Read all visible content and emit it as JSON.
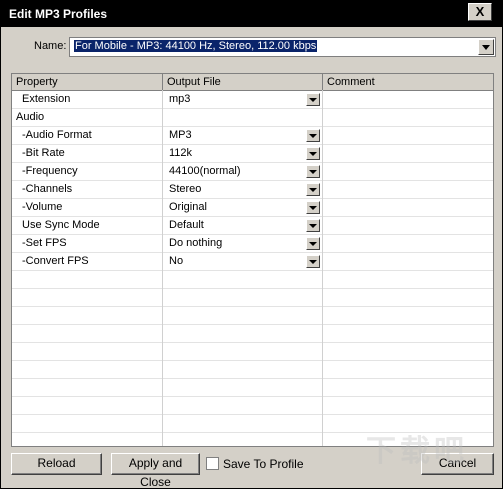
{
  "window": {
    "title": "Edit MP3 Profiles",
    "close_glyph": "X"
  },
  "name_field": {
    "label": "Name:",
    "value": "For Mobile - MP3: 44100 Hz, Stereo, 112.00 kbps"
  },
  "table": {
    "headers": [
      "Property",
      "Output File",
      "Comment"
    ],
    "rows": [
      {
        "property": "Extension",
        "value": "mp3",
        "dropdown": true
      },
      {
        "property": "Audio",
        "value": "",
        "dropdown": false
      },
      {
        "property": "-Audio Format",
        "value": "MP3",
        "dropdown": true
      },
      {
        "property": "-Bit Rate",
        "value": "112k",
        "dropdown": true
      },
      {
        "property": "-Frequency",
        "value": "44100(normal)",
        "dropdown": true
      },
      {
        "property": "-Channels",
        "value": "Stereo",
        "dropdown": true
      },
      {
        "property": "-Volume",
        "value": "Original",
        "dropdown": true
      },
      {
        "property": "Use Sync Mode",
        "value": "Default",
        "dropdown": true
      },
      {
        "property": "-Set FPS",
        "value": "Do nothing",
        "dropdown": true
      },
      {
        "property": "-Convert FPS",
        "value": "No",
        "dropdown": true
      }
    ]
  },
  "buttons": {
    "reload": "Reload",
    "apply_close": "Apply and Close",
    "cancel": "Cancel"
  },
  "save_to_profile": {
    "label": "Save To Profile",
    "checked": false
  },
  "watermark": "下载吧"
}
